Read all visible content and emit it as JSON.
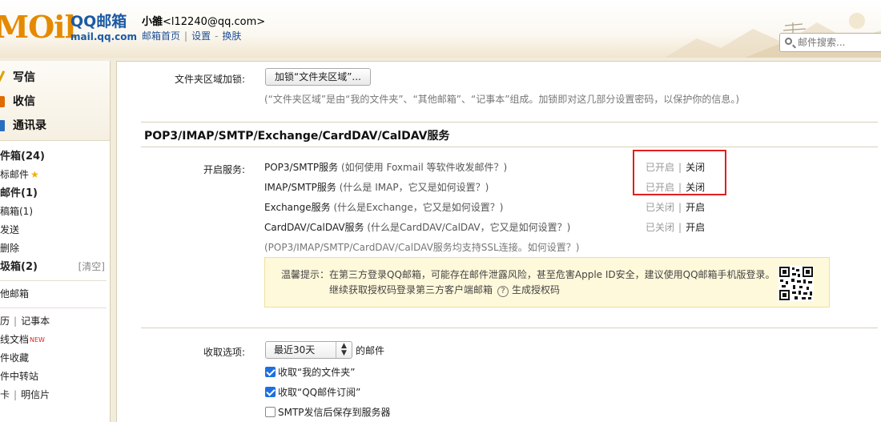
{
  "header": {
    "logo_text": "MOil",
    "logo_brand": "QQ邮箱",
    "logo_url": "mail.qq.com",
    "user_name": "小雒",
    "user_email": "<l12240@qq.com>",
    "links": [
      "邮箱首页",
      "设置",
      "换肤"
    ],
    "search_placeholder": "邮件搜索..."
  },
  "sidebar": {
    "primary": [
      {
        "label": "写信",
        "icon": "pen-icon"
      },
      {
        "label": "收信",
        "icon": "inbox-icon"
      },
      {
        "label": "通讯录",
        "icon": "contacts-icon"
      }
    ],
    "folders": [
      {
        "label": "件箱(24)",
        "bold": true
      },
      {
        "label": "标邮件",
        "star": "★"
      },
      {
        "label": "邮件(1)",
        "bold": true
      },
      {
        "label": "稿箱(1)"
      },
      {
        "label": "发送"
      },
      {
        "label": "删除"
      },
      {
        "label": "圾箱(2)",
        "bold": true,
        "extra": "[清空]"
      }
    ],
    "other_mailbox": "他邮箱",
    "tools": {
      "calendar": "历",
      "notes": "记事本",
      "docs": "线文档",
      "docs_badge": "NEW",
      "favorites": "件收藏",
      "transfer": "件中转站",
      "card": "卡",
      "postcard": "明信片"
    }
  },
  "main": {
    "folder_lock": {
      "label": "文件夹区域加锁:",
      "button": "加锁“文件夹区域”...",
      "note": "(“文件夹区域”是由“我的文件夹”、“其他邮箱”、“记事本”组成。加锁即对这几部分设置密码，以保护你的信息。)"
    },
    "section_title": "POP3/IMAP/SMTP/Exchange/CardDAV/CalDAV服务",
    "services_label": "开启服务:",
    "services": [
      {
        "name": "POP3/SMTP服务",
        "hint": "(如何使用 Foxmail 等软件收发邮件？)",
        "status": "已开启",
        "action": "关闭"
      },
      {
        "name": "IMAP/SMTP服务",
        "hint": "(什么是 IMAP，它又是如何设置？)",
        "status": "已开启",
        "action": "关闭"
      },
      {
        "name": "Exchange服务",
        "hint": "(什么是Exchange，它又是如何设置？)",
        "status": "已关闭",
        "action": "开启"
      },
      {
        "name": "CardDAV/CalDAV服务",
        "hint": "(什么是CardDAV/CalDAV，它又是如何设置？)",
        "status": "已关闭",
        "action": "开启"
      }
    ],
    "ssl_note": "(POP3/IMAP/SMTP/CardDAV/CalDAV服务均支持SSL连接。如何设置？)",
    "tip": {
      "line1": "温馨提示：在第三方登录QQ邮箱，可能存在邮件泄露风险，甚至危害Apple ID安全，建议使用QQ邮箱手机版登录。",
      "line2_a": "继续获取授权码登录第三方客户端邮箱",
      "help": "?",
      "line2_b": "生成授权码"
    },
    "receive": {
      "label": "收取选项:",
      "select_value": "最近30天",
      "after_select": "的邮件",
      "checkboxes": [
        {
          "label": "收取“我的文件夹”",
          "checked": true
        },
        {
          "label": "收取“QQ邮件订阅”",
          "checked": true
        },
        {
          "label": "SMTP发信后保存到服务器",
          "checked": false
        }
      ]
    }
  },
  "colors": {
    "accent_orange": "#e58a00",
    "brand_blue": "#1b5aa3",
    "highlight_red": "#e02020",
    "tip_bg": "#fff9db"
  }
}
